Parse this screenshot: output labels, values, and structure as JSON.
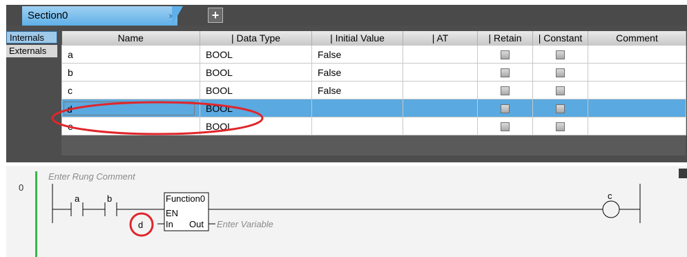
{
  "tab": {
    "title": "Section0",
    "close": "×",
    "add": "+"
  },
  "side_tabs": [
    "Internals",
    "Externals"
  ],
  "table": {
    "headers": [
      "Name",
      "Data Type",
      "Initial Value",
      "AT",
      "Retain",
      "Constant",
      "Comment"
    ],
    "header_prefix": [
      "",
      "|",
      "|",
      "|",
      "|",
      "|",
      ""
    ],
    "rows": [
      {
        "name": "a",
        "type": "BOOL",
        "init": "False"
      },
      {
        "name": "b",
        "type": "BOOL",
        "init": "False"
      },
      {
        "name": "c",
        "type": "BOOL",
        "init": "False"
      },
      {
        "name": "d",
        "type": "BOOL",
        "init": ""
      },
      {
        "name": "e",
        "type": "BOOL",
        "init": ""
      }
    ]
  },
  "ladder": {
    "rung_number": "0",
    "rung_comment": "Enter Rung Comment",
    "contact_a": "a",
    "contact_b": "b",
    "fb_name": "Function0",
    "fb_en": "EN",
    "fb_in": "In",
    "fb_out": "Out",
    "input_var": "d",
    "output_placeholder": "Enter Variable",
    "coil": "c"
  },
  "colors": {
    "accent": "#5aa9e0",
    "highlight_circle": "#e0262b",
    "rung_bar": "#39b54a"
  }
}
